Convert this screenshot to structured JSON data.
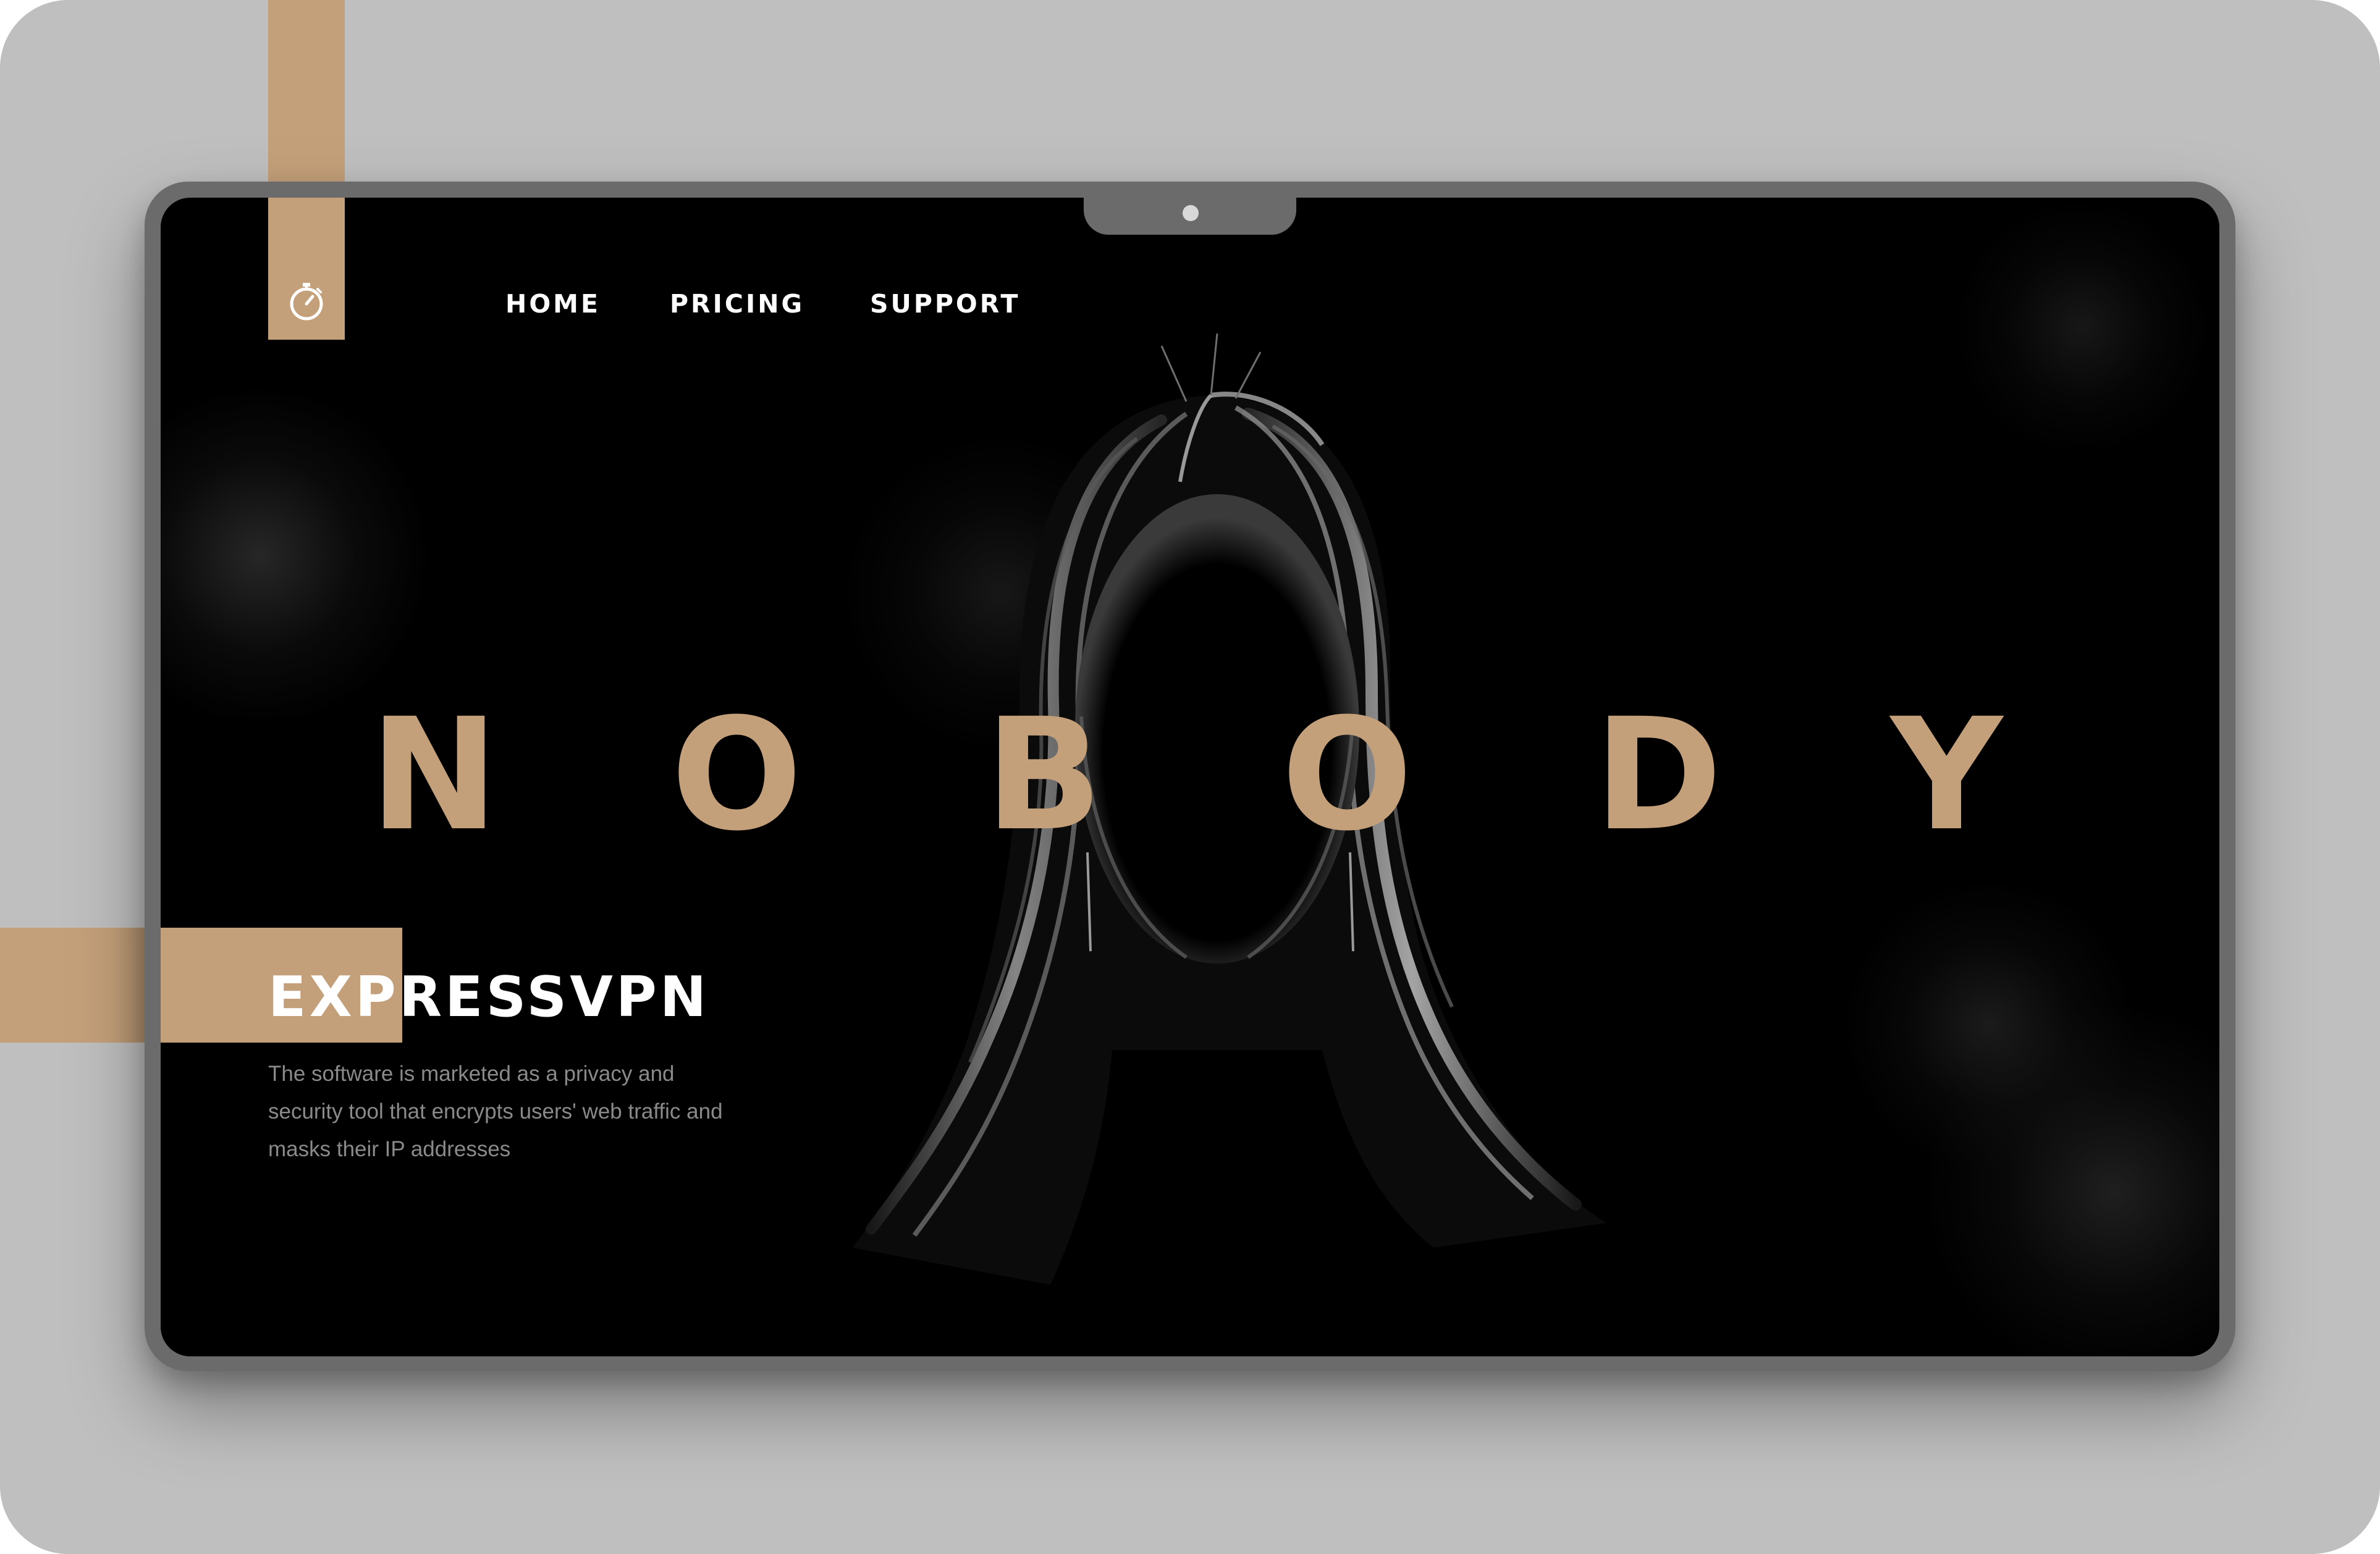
{
  "colors": {
    "accent": "#c4a07a",
    "backdrop": "#bfbfbf",
    "device_frame": "#6b6b6b",
    "screen_bg": "#000000",
    "body_text": "#8a8a8a"
  },
  "logo": {
    "icon": "stopwatch-icon"
  },
  "nav": {
    "items": [
      {
        "label": "HOME"
      },
      {
        "label": "PRICING"
      },
      {
        "label": "SUPPORT"
      }
    ]
  },
  "hero": {
    "letters": [
      "N",
      "O",
      "B",
      "O",
      "D",
      "Y"
    ]
  },
  "brand": {
    "title": "EXPRESSVPN",
    "description": "The software is marketed as a privacy and security tool that encrypts users' web traffic and masks their IP addresses"
  }
}
